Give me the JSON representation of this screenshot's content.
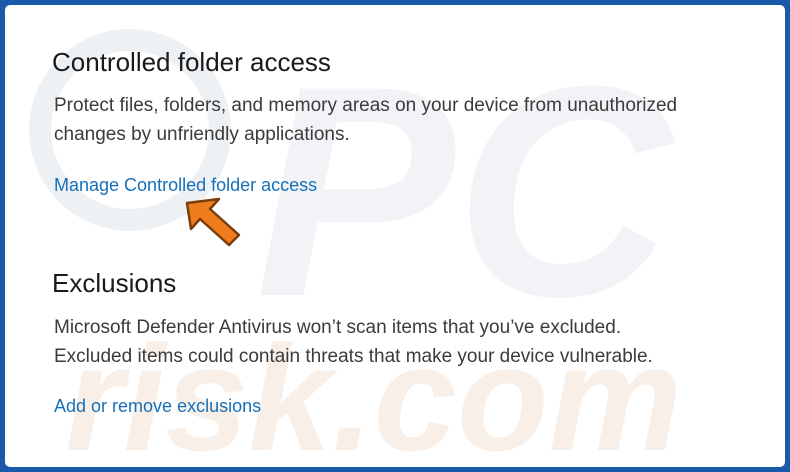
{
  "watermark": {
    "text_top": "PC",
    "text_bottom": "risk.com"
  },
  "controlled_folder": {
    "title": "Controlled folder access",
    "description_line1": "Protect files, folders, and memory areas on your device from unauthorized",
    "description_line2": "changes by unfriendly applications.",
    "link_label": "Manage Controlled folder access"
  },
  "exclusions": {
    "title": "Exclusions",
    "description_line1": "Microsoft Defender Antivirus won’t scan items that you’ve excluded.",
    "description_line2": "Excluded items could contain threats that make your device vulnerable.",
    "link_label": "Add or remove exclusions"
  },
  "colors": {
    "frame_border": "#1b5aa8",
    "link": "#1670b9",
    "arrow_fill": "#f07d1d",
    "watermark": "#eef1f6"
  },
  "icons": {
    "pointer": "arrow-pointer-icon"
  }
}
